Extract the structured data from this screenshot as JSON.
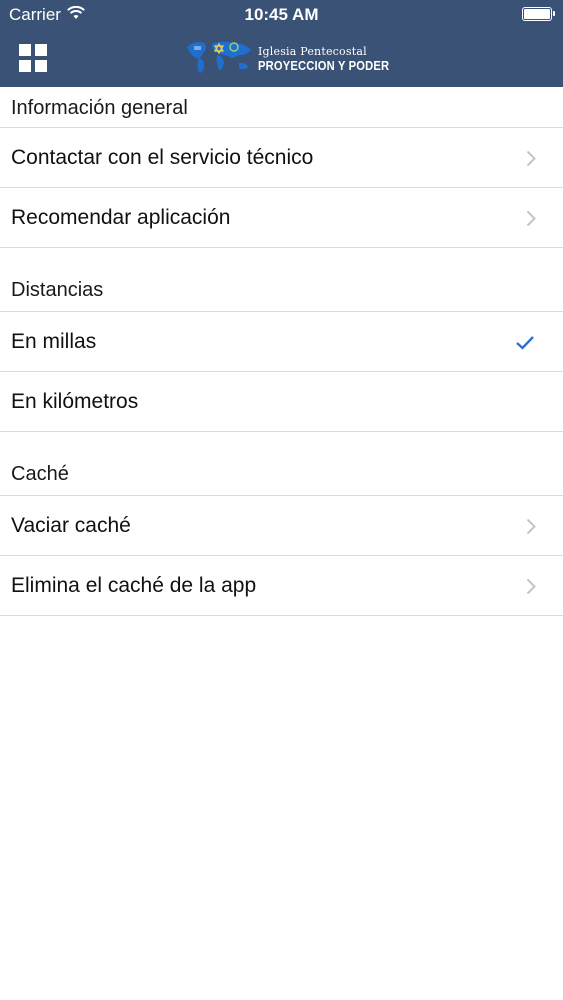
{
  "status_bar": {
    "carrier": "Carrier",
    "time": "10:45 AM",
    "battery_level": 1.0
  },
  "nav_bar": {
    "menu_icon": "grid-icon",
    "logo": {
      "line1": "Iglesia Pentecostal",
      "line2": "PROYECCION Y PODER"
    },
    "bg_color": "#3a5275"
  },
  "sections": [
    {
      "title": "Información general",
      "rows": [
        {
          "label": "Contactar con el servicio técnico",
          "accessory": "chevron-right-icon"
        },
        {
          "label": "Recomendar aplicación",
          "accessory": "chevron-right-icon"
        }
      ]
    },
    {
      "title": "Distancias",
      "rows": [
        {
          "label": "En millas",
          "accessory": "checkmark-icon",
          "selected": true
        },
        {
          "label": "En kilómetros",
          "accessory": "none",
          "selected": false
        }
      ]
    },
    {
      "title": "Caché",
      "rows": [
        {
          "label": "Vaciar caché",
          "accessory": "chevron-right-icon"
        },
        {
          "label": "Elimina el caché de la app",
          "accessory": "chevron-right-icon"
        }
      ]
    }
  ],
  "colors": {
    "accent": "#2f6fd1",
    "chevron": "#c4c4c9",
    "separator": "#dcdcdc"
  }
}
